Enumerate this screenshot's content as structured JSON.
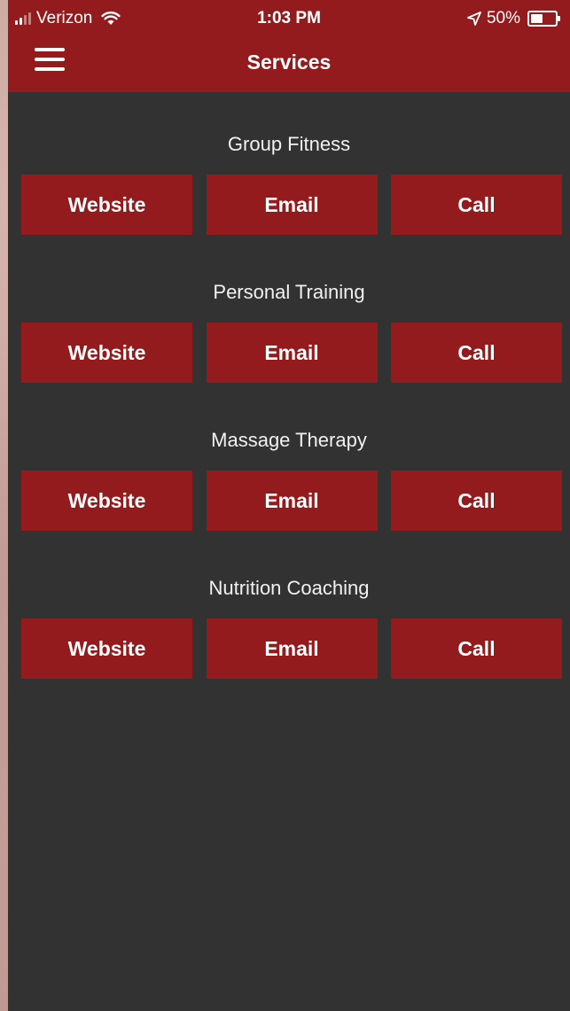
{
  "status_bar": {
    "carrier": "Verizon",
    "time": "1:03 PM",
    "battery": "50%",
    "battery_level": 0.5
  },
  "nav": {
    "title": "Services",
    "menu_icon": "hamburger-menu-icon"
  },
  "colors": {
    "header": "#931b1e",
    "button": "#931b1e",
    "background": "#323232",
    "text": "#ffffff"
  },
  "services": [
    {
      "name": "Group Fitness",
      "website": "Website",
      "email": "Email",
      "call": "Call"
    },
    {
      "name": "Personal Training",
      "website": "Website",
      "email": "Email",
      "call": "Call"
    },
    {
      "name": "Massage Therapy",
      "website": "Website",
      "email": "Email",
      "call": "Call"
    },
    {
      "name": "Nutrition Coaching",
      "website": "Website",
      "email": "Email",
      "call": "Call"
    }
  ]
}
